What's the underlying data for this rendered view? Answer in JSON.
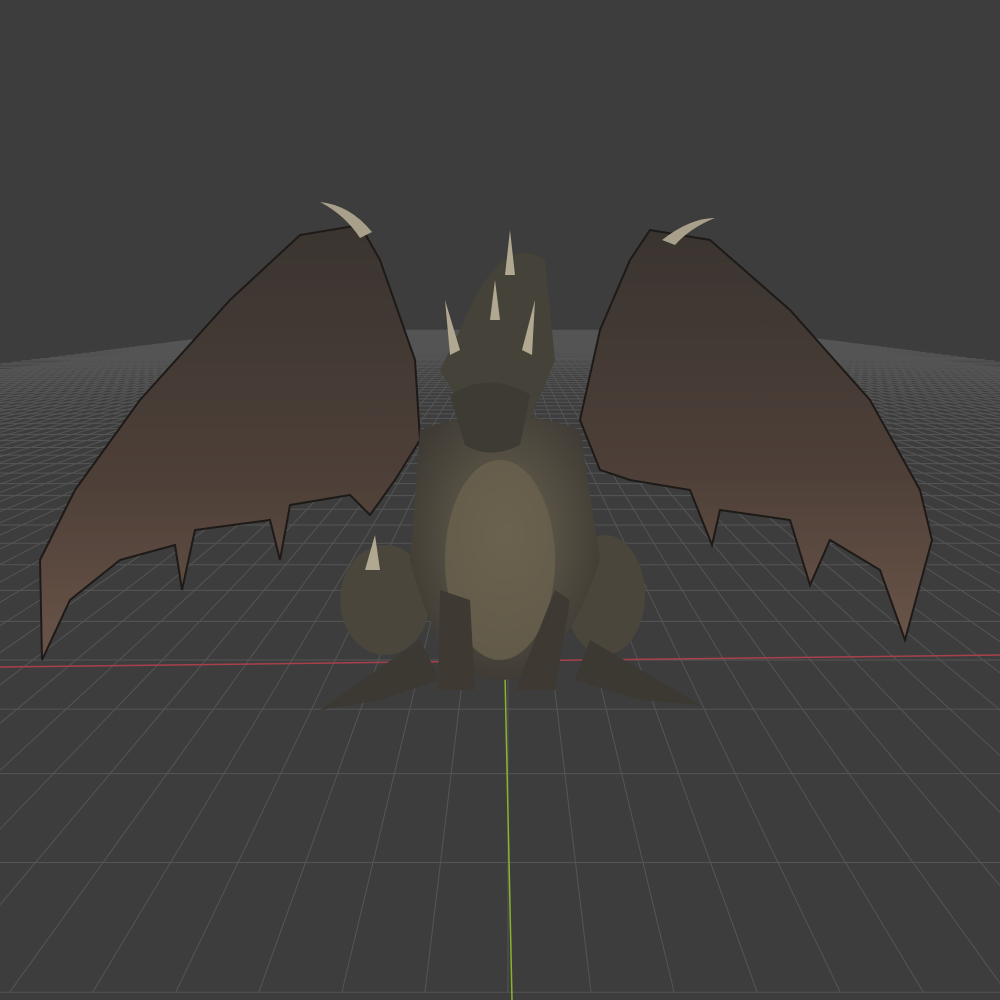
{
  "viewport": {
    "background_color": "#3d3d3d",
    "grid_color": "#555555",
    "x_axis_color": "#a8404c",
    "y_axis_color": "#8ab42a"
  },
  "model": {
    "wing_color": "#4a3e36",
    "wing_edge_color": "#6b5448",
    "body_color": "#4e4a40",
    "belly_color": "#6a624e",
    "horn_color": "#b0a890"
  }
}
